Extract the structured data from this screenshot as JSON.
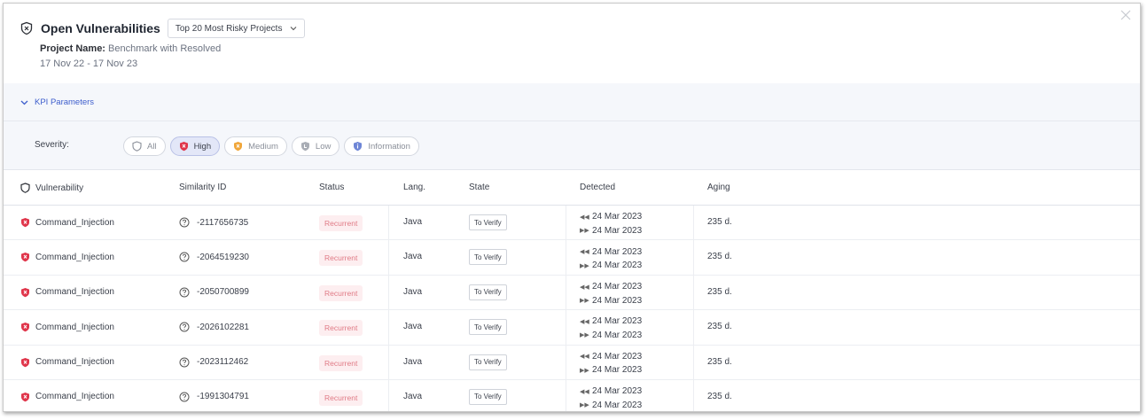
{
  "header": {
    "title": "Open Vulnerabilities",
    "dropdown_label": "Top 20 Most Risky Projects",
    "project_label": "Project Name:",
    "project_name": "Benchmark with Resolved",
    "date_range": "17 Nov 22 - 17 Nov 23"
  },
  "kpi": {
    "label": "KPI Parameters"
  },
  "severity": {
    "label": "Severity:",
    "chips": [
      {
        "label": "All",
        "active": false,
        "color": "#8a8f99"
      },
      {
        "label": "High",
        "active": true,
        "color": "#e0364b"
      },
      {
        "label": "Medium",
        "active": false,
        "color": "#f0a63a"
      },
      {
        "label": "Low",
        "active": false,
        "color": "#a9adb5"
      },
      {
        "label": "Information",
        "active": false,
        "color": "#6e86d6"
      }
    ]
  },
  "table": {
    "columns": {
      "vulnerability": "Vulnerability",
      "similarity": "Similarity ID",
      "status": "Status",
      "lang": "Lang.",
      "state": "State",
      "detected": "Detected",
      "aging": "Aging"
    },
    "rows": [
      {
        "vulnerability": "Command_Injection",
        "similarity_id": "-2117656735",
        "status": "Recurrent",
        "lang": "Java",
        "state": "To Verify",
        "detected_first": "24 Mar 2023",
        "detected_last": "24 Mar 2023",
        "aging": "235 d."
      },
      {
        "vulnerability": "Command_Injection",
        "similarity_id": "-2064519230",
        "status": "Recurrent",
        "lang": "Java",
        "state": "To Verify",
        "detected_first": "24 Mar 2023",
        "detected_last": "24 Mar 2023",
        "aging": "235 d."
      },
      {
        "vulnerability": "Command_Injection",
        "similarity_id": "-2050700899",
        "status": "Recurrent",
        "lang": "Java",
        "state": "To Verify",
        "detected_first": "24 Mar 2023",
        "detected_last": "24 Mar 2023",
        "aging": "235 d."
      },
      {
        "vulnerability": "Command_Injection",
        "similarity_id": "-2026102281",
        "status": "Recurrent",
        "lang": "Java",
        "state": "To Verify",
        "detected_first": "24 Mar 2023",
        "detected_last": "24 Mar 2023",
        "aging": "235 d."
      },
      {
        "vulnerability": "Command_Injection",
        "similarity_id": "-2023112462",
        "status": "Recurrent",
        "lang": "Java",
        "state": "To Verify",
        "detected_first": "24 Mar 2023",
        "detected_last": "24 Mar 2023",
        "aging": "235 d."
      },
      {
        "vulnerability": "Command_Injection",
        "similarity_id": "-1991304791",
        "status": "Recurrent",
        "lang": "Java",
        "state": "To Verify",
        "detected_first": "24 Mar 2023",
        "detected_last": "24 Mar 2023",
        "aging": "235 d."
      }
    ]
  },
  "colors": {
    "high": "#e0364b",
    "accent": "#3d5dcc",
    "recurrent_bg": "#fdeef0",
    "recurrent_text": "#e07a85"
  }
}
